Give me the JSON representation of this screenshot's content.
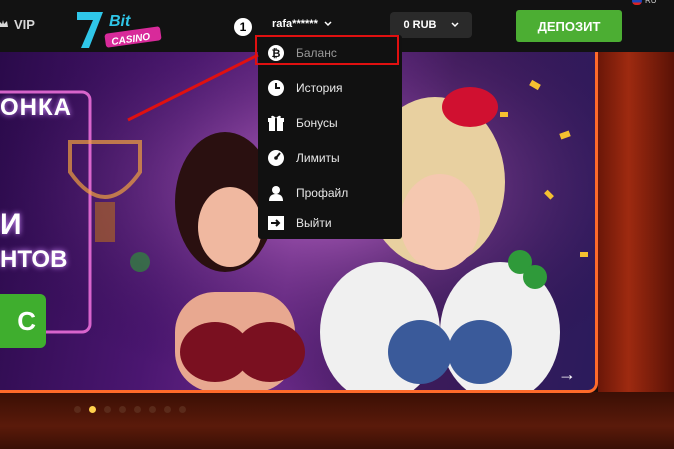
{
  "header": {
    "vip_label": "VIP",
    "logo_text": "7Bit CASINO",
    "username": "rafa******",
    "balance": "0 RUB",
    "deposit_label": "ДЕПОЗИТ",
    "language": "RU",
    "step_number": "1"
  },
  "banner": {
    "line1": "ОНКА",
    "line2": "И",
    "line3": "НТОВ",
    "button_label": "С"
  },
  "menu": {
    "items": [
      {
        "label": "Баланс",
        "icon": "bitcoin-icon"
      },
      {
        "label": "История",
        "icon": "clock-icon"
      },
      {
        "label": "Бонусы",
        "icon": "gift-icon"
      },
      {
        "label": "Лимиты",
        "icon": "gauge-icon"
      },
      {
        "label": "Профайл",
        "icon": "user-icon"
      },
      {
        "label": "Выйти",
        "icon": "logout-icon"
      }
    ]
  },
  "slider": {
    "dot_count": 8,
    "active_index": 2
  },
  "colors": {
    "accent_green": "#4cae33",
    "annotation_red": "#e01010",
    "frame_orange": "#ff6a2a"
  }
}
